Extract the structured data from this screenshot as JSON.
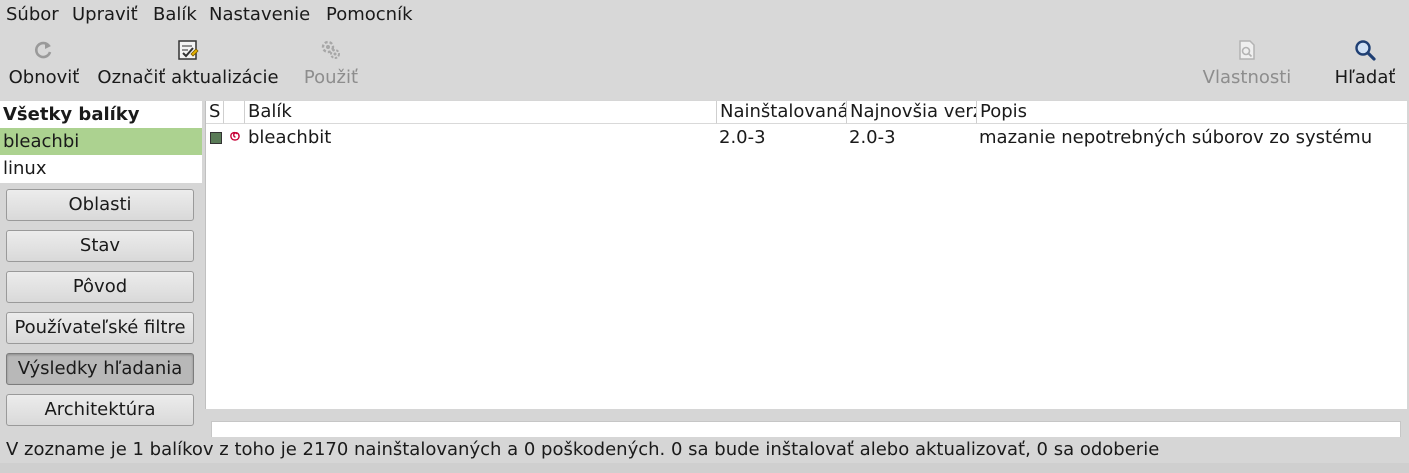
{
  "menu": [
    "Súbor",
    "Upraviť",
    "Balík",
    "Nastavenie",
    "Pomocník"
  ],
  "toolbar": {
    "reload": {
      "label": "Obnoviť",
      "icon": "reload-icon"
    },
    "mark_upgrades": {
      "label": "Označiť aktualizácie",
      "icon": "mark-upgrades-icon"
    },
    "apply": {
      "label": "Použiť",
      "icon": "apply-icon",
      "enabled": false
    },
    "properties": {
      "label": "Vlastnosti",
      "icon": "properties-icon",
      "enabled": false
    },
    "search": {
      "label": "Hľadať",
      "icon": "search-icon"
    }
  },
  "sidebar": {
    "header": "Všetky balíky",
    "items": [
      "bleachbi",
      "linux"
    ],
    "selected": "bleachbi",
    "filters": [
      "Oblasti",
      "Stav",
      "Pôvod",
      "Používateľské filtre",
      "Výsledky hľadania",
      "Architektúra"
    ],
    "active_filter": "Výsledky hľadania"
  },
  "table": {
    "columns": [
      "S",
      "",
      "Balík",
      "Nainštalovaná",
      "Najnovšia verzia",
      "Popis"
    ],
    "rows": [
      {
        "status_color": "#5a7b57",
        "origin_icon": "debian-icon",
        "package": "bleachbit",
        "installed": "2.0-3",
        "latest": "2.0-3",
        "description": "mazanie nepotrebných súborov zo systému"
      }
    ]
  },
  "statusbar": "V zozname je 1 balíkov z toho je 2170 nainštalovaných a 0 poškodených. 0 sa bude inštalovať alebo aktualizovať, 0 sa odoberie"
}
